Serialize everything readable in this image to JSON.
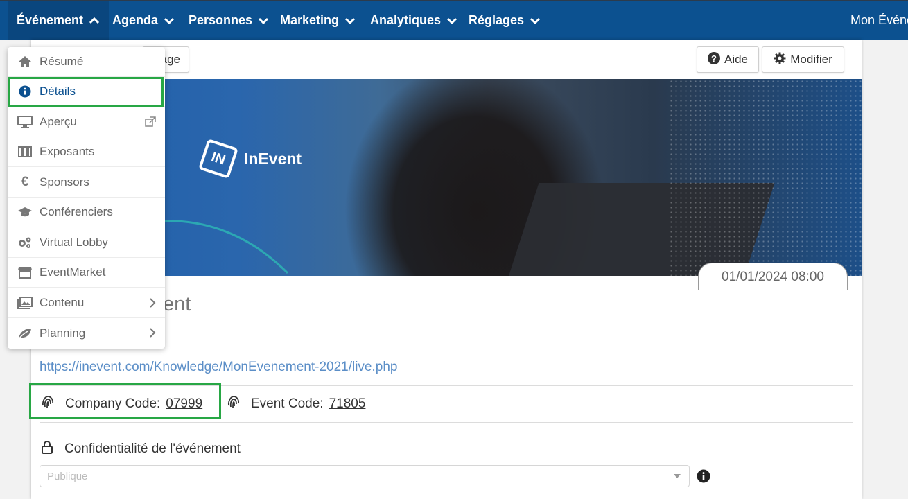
{
  "nav": {
    "items": [
      {
        "label": "Événement"
      },
      {
        "label": "Agenda"
      },
      {
        "label": "Personnes"
      },
      {
        "label": "Marketing"
      },
      {
        "label": "Analytiques"
      },
      {
        "label": "Réglages"
      }
    ],
    "right_label": "Mon Événe"
  },
  "toolbar": {
    "partial_button_label": "age",
    "help_label": "Aide",
    "edit_label": "Modifier"
  },
  "banner": {
    "logo_text": "InEvent",
    "logo_mark": "IN",
    "date": "01/01/2024 08:00"
  },
  "event": {
    "title_partial": "ent",
    "url": "https://inevent.com/Knowledge/MonEvenement-2021/live.php",
    "company_code_label": "Company Code:",
    "company_code": "07999",
    "event_code_label": "Event Code:",
    "event_code": "71805",
    "privacy_label": "Confidentialité de l'événement",
    "privacy_value": "Publique"
  },
  "menu": {
    "items": [
      {
        "label": "Résumé",
        "icon": "home-icon"
      },
      {
        "label": "Détails",
        "icon": "info-circle-icon"
      },
      {
        "label": "Aperçu",
        "icon": "monitor-icon"
      },
      {
        "label": "Exposants",
        "icon": "booth-icon"
      },
      {
        "label": "Sponsors",
        "icon": "euro-icon"
      },
      {
        "label": "Conférenciers",
        "icon": "graduation-cap-icon"
      },
      {
        "label": "Virtual Lobby",
        "icon": "gears-icon"
      },
      {
        "label": "EventMarket",
        "icon": "store-icon"
      },
      {
        "label": "Contenu",
        "icon": "images-icon"
      },
      {
        "label": "Planning",
        "icon": "leaf-icon"
      }
    ]
  },
  "colors": {
    "nav_bg": "#0c5190",
    "highlight": "#28a745",
    "link": "#5b8ec7"
  }
}
